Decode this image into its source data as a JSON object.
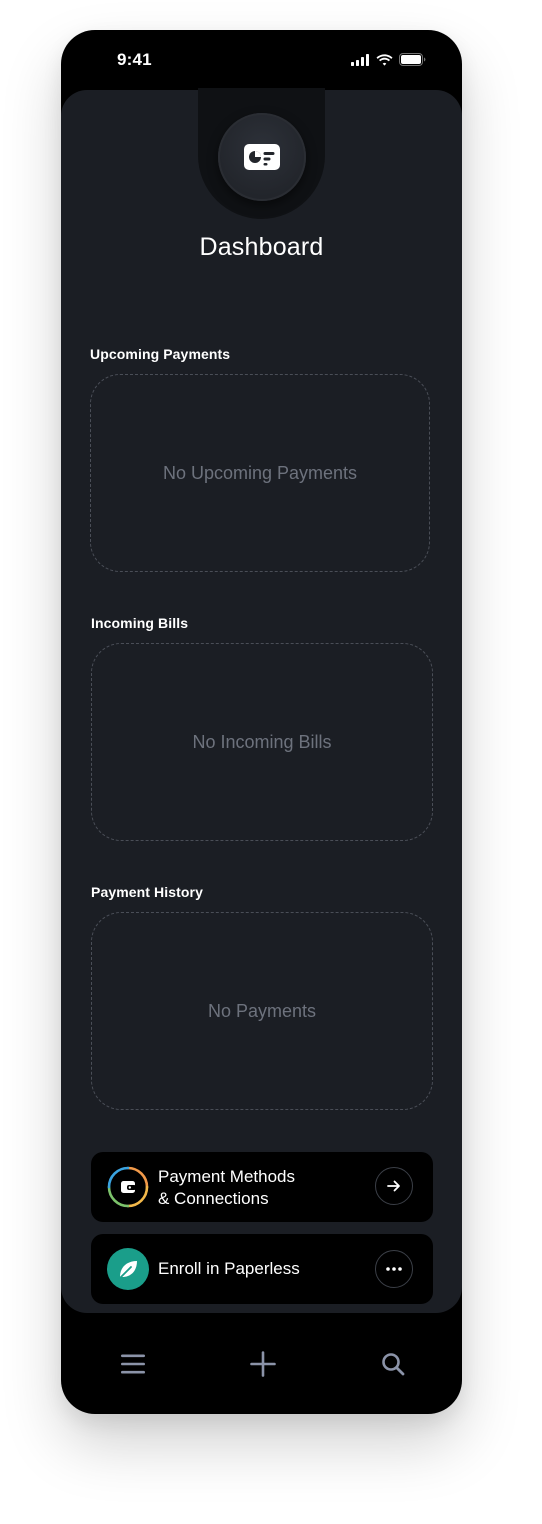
{
  "status": {
    "time": "9:41"
  },
  "header": {
    "title": "Dashboard",
    "badge_icon": "wallet-card-icon"
  },
  "sections": [
    {
      "label": "Upcoming Payments",
      "empty_text": "No Upcoming Payments"
    },
    {
      "label": "Incoming Bills",
      "empty_text": "No Incoming Bills"
    },
    {
      "label": "Payment History",
      "empty_text": "No Payments"
    }
  ],
  "actions": {
    "payment_methods": {
      "line1": "Payment Methods",
      "line2": "& Connections",
      "icon": "wallet-icon",
      "button_icon": "arrow-right-icon"
    },
    "paperless": {
      "label": "Enroll in Paperless",
      "icon": "leaf-icon",
      "button_icon": "more-horizontal-icon",
      "icon_color": "#1a9e8a"
    }
  },
  "nav": {
    "items": [
      "menu-icon",
      "plus-icon",
      "search-icon"
    ],
    "icon_color": "#8b93a8"
  },
  "colors": {
    "card_background": "#1b1e24",
    "frame": "#000000",
    "muted_text": "#6d727d"
  }
}
